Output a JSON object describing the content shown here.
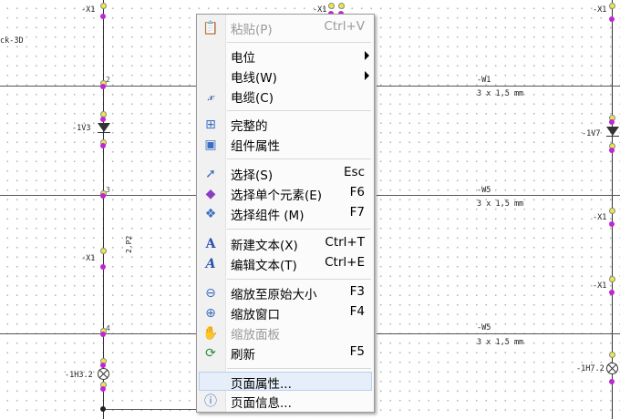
{
  "schematic": {
    "labels": {
      "x1_top_left": "-X1",
      "x1_top_mid": "-X1",
      "x1_top_right": "-X1",
      "x1_mid_left": "-X1",
      "x1_right_1": "-X1",
      "x1_right_2": "-X1",
      "ck3d": "ck-3D",
      "v13": "-1V3",
      "v17": "-1V7",
      "h32": "-1H3.2",
      "h72": "-1H7.2",
      "p2": "2.P2"
    },
    "node_numbers": {
      "n2": "2",
      "n3": "3",
      "n4": "4"
    },
    "wires": [
      {
        "name": "-W1",
        "spec": "3 x 1,5 mm"
      },
      {
        "name": "-W5",
        "spec": "3 x 1,5 mm"
      },
      {
        "name": "-W5",
        "spec": "3 x 1,5 mm"
      }
    ]
  },
  "context_menu": {
    "items": [
      {
        "label": "粘贴(P)",
        "shortcut": "Ctrl+V",
        "icon": "paste-icon",
        "disabled": true
      },
      {
        "label": "电位",
        "submenu": true
      },
      {
        "label": "电线(W)",
        "submenu": true
      },
      {
        "label": "电缆(C)",
        "icon": "cable-icon"
      },
      {
        "label": "完整的",
        "icon": "complete-icon"
      },
      {
        "label": "组件属性",
        "icon": "component-properties-icon"
      },
      {
        "label": "选择(S)",
        "shortcut": "Esc",
        "icon": "select-arrow-icon"
      },
      {
        "label": "选择单个元素(E)",
        "shortcut": "F6",
        "icon": "select-element-icon"
      },
      {
        "label": "选择组件 (M)",
        "shortcut": "F7",
        "icon": "select-component-icon"
      },
      {
        "label": "新建文本(X)",
        "shortcut": "Ctrl+T",
        "icon": "new-text-icon"
      },
      {
        "label": "编辑文本(T)",
        "shortcut": "Ctrl+E",
        "icon": "edit-text-icon"
      },
      {
        "label": "缩放至原始大小",
        "shortcut": "F3",
        "icon": "zoom-original-icon"
      },
      {
        "label": "缩放窗口",
        "shortcut": "F4",
        "icon": "zoom-window-icon"
      },
      {
        "label": "缩放面板",
        "icon": "pan-hand-icon",
        "disabled": true
      },
      {
        "label": "刷新",
        "shortcut": "F5",
        "icon": "refresh-icon"
      },
      {
        "label": "页面属性...",
        "highlighted": true
      },
      {
        "label": "页面信息...",
        "icon": "page-info-icon"
      }
    ]
  }
}
